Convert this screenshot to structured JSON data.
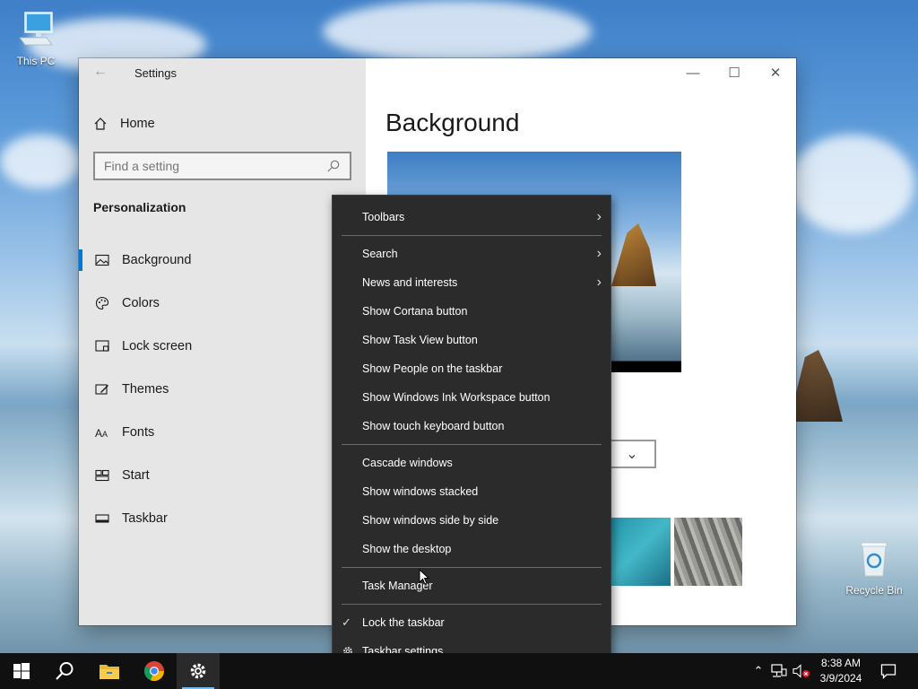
{
  "desktop": {
    "icons": [
      {
        "label": "This PC"
      },
      {
        "label": "Recycle Bin"
      }
    ]
  },
  "settings_window": {
    "title": "Settings",
    "home_label": "Home",
    "search": {
      "placeholder": "Find a setting",
      "value": ""
    },
    "section_title": "Personalization",
    "nav_items": [
      {
        "label": "Background",
        "icon": "image-icon",
        "active": true
      },
      {
        "label": "Colors",
        "icon": "palette-icon",
        "active": false
      },
      {
        "label": "Lock screen",
        "icon": "lock-screen-icon",
        "active": false
      },
      {
        "label": "Themes",
        "icon": "themes-brush-icon",
        "active": false
      },
      {
        "label": "Fonts",
        "icon": "fonts-icon",
        "active": false
      },
      {
        "label": "Start",
        "icon": "start-layout-icon",
        "active": false
      },
      {
        "label": "Taskbar",
        "icon": "taskbar-icon",
        "active": false
      }
    ],
    "page_heading": "Background",
    "controls": {
      "minimize": "minimize-icon",
      "maximize": "maximize-icon",
      "close": "close-icon"
    }
  },
  "context_menu": {
    "groups": [
      [
        {
          "label": "Toolbars",
          "submenu": true
        }
      ],
      [
        {
          "label": "Search",
          "submenu": true
        },
        {
          "label": "News and interests",
          "submenu": true
        },
        {
          "label": "Show Cortana button"
        },
        {
          "label": "Show Task View button"
        },
        {
          "label": "Show People on the taskbar"
        },
        {
          "label": "Show Windows Ink Workspace button"
        },
        {
          "label": "Show touch keyboard button"
        }
      ],
      [
        {
          "label": "Cascade windows"
        },
        {
          "label": "Show windows stacked"
        },
        {
          "label": "Show windows side by side"
        },
        {
          "label": "Show the desktop"
        }
      ],
      [
        {
          "label": "Task Manager"
        }
      ],
      [
        {
          "label": "Lock the taskbar",
          "checked": true
        },
        {
          "label": "Taskbar settings",
          "icon": "gear-icon"
        }
      ]
    ]
  },
  "taskbar": {
    "apps": [
      {
        "name": "start-button",
        "icon": "windows-logo-icon"
      },
      {
        "name": "search-button",
        "icon": "search-icon"
      },
      {
        "name": "file-explorer-button",
        "icon": "folder-icon"
      },
      {
        "name": "chrome-button",
        "icon": "chrome-icon"
      },
      {
        "name": "settings-app-button",
        "icon": "gear-icon",
        "active": true
      }
    ],
    "clock": {
      "time": "8:38 AM",
      "date": "3/9/2024"
    }
  }
}
